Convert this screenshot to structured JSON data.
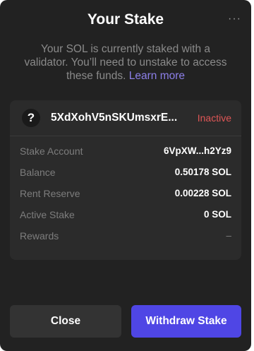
{
  "header": {
    "title": "Your Stake",
    "more_icon": "more-horizontal-icon"
  },
  "description": {
    "text": "Your SOL is currently staked with a validator. You’ll need to unstake to access these funds.",
    "link": "Learn more"
  },
  "stake_card": {
    "validator_icon": "question-mark-icon",
    "validator_name": "5XdXohV5nSKUmsxrE...",
    "status": "Inactive",
    "status_color": "#e05656",
    "rows": [
      {
        "label": "Stake Account",
        "value": "6VpXW...h2Yz9"
      },
      {
        "label": "Balance",
        "value": "0.50178 SOL"
      },
      {
        "label": "Rent Reserve",
        "value": "0.00228 SOL"
      },
      {
        "label": "Active Stake",
        "value": "0 SOL"
      },
      {
        "label": "Rewards",
        "value": "–"
      }
    ]
  },
  "footer": {
    "close_label": "Close",
    "withdraw_label": "Withdraw Stake",
    "accent_color": "#4f46e5"
  }
}
